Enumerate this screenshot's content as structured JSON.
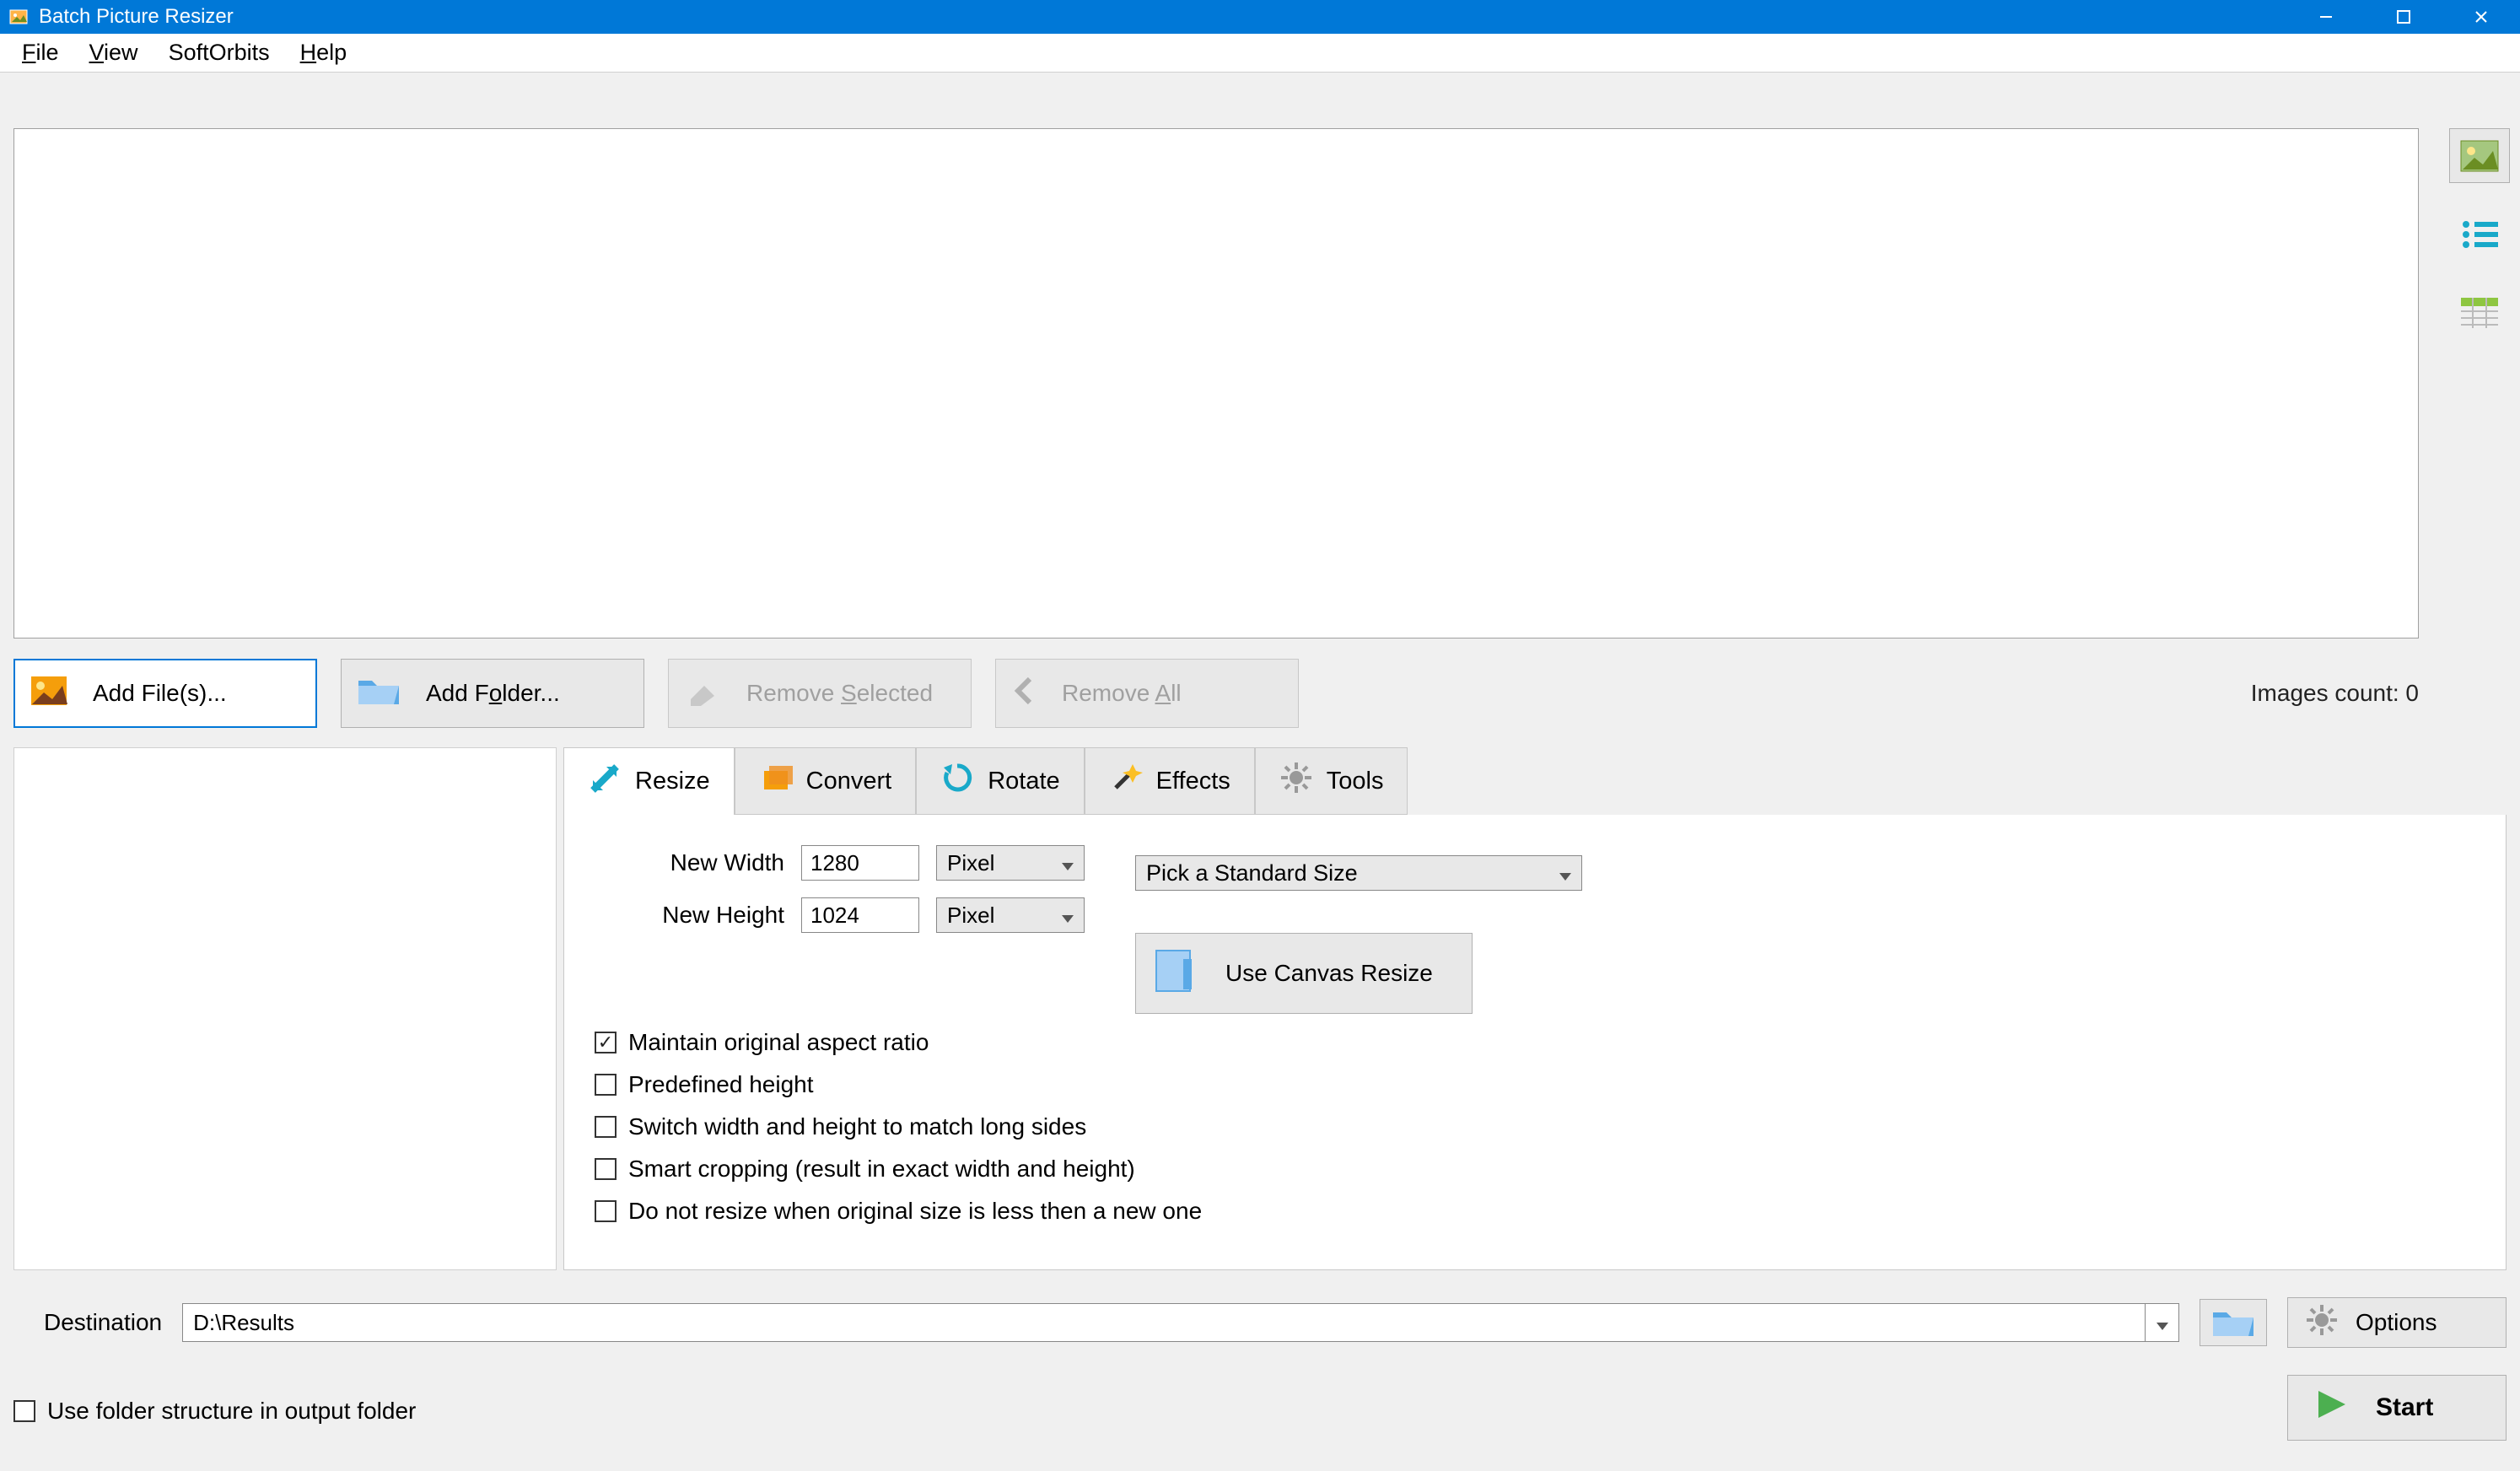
{
  "title": "Batch Picture Resizer",
  "menu": {
    "file": "File",
    "view": "View",
    "softorbits": "SoftOrbits",
    "help": "Help"
  },
  "filebar": {
    "add_file": "Add File(s)...",
    "add_folder": "Add Folder...",
    "remove_selected": "Remove Selected",
    "remove_all": "Remove All",
    "count_label": "Images count: 0"
  },
  "tabs": {
    "resize": "Resize",
    "convert": "Convert",
    "rotate": "Rotate",
    "effects": "Effects",
    "tools": "Tools"
  },
  "resize": {
    "width_label": "New Width",
    "width_value": "1280",
    "height_label": "New Height",
    "height_value": "1024",
    "unit": "Pixel",
    "std_size": "Pick a Standard Size",
    "canvas": "Use Canvas Resize",
    "maintain_ratio": "Maintain original aspect ratio",
    "predefined_height": "Predefined height",
    "switch_sides": "Switch width and height to match long sides",
    "smart_crop": "Smart cropping (result in exact width and height)",
    "no_resize_small": "Do not resize when original size is less then a new one"
  },
  "bottom": {
    "dest_label": "Destination",
    "dest_value": "D:\\Results",
    "options": "Options",
    "start": "Start",
    "folder_struct": "Use folder structure in output folder"
  }
}
